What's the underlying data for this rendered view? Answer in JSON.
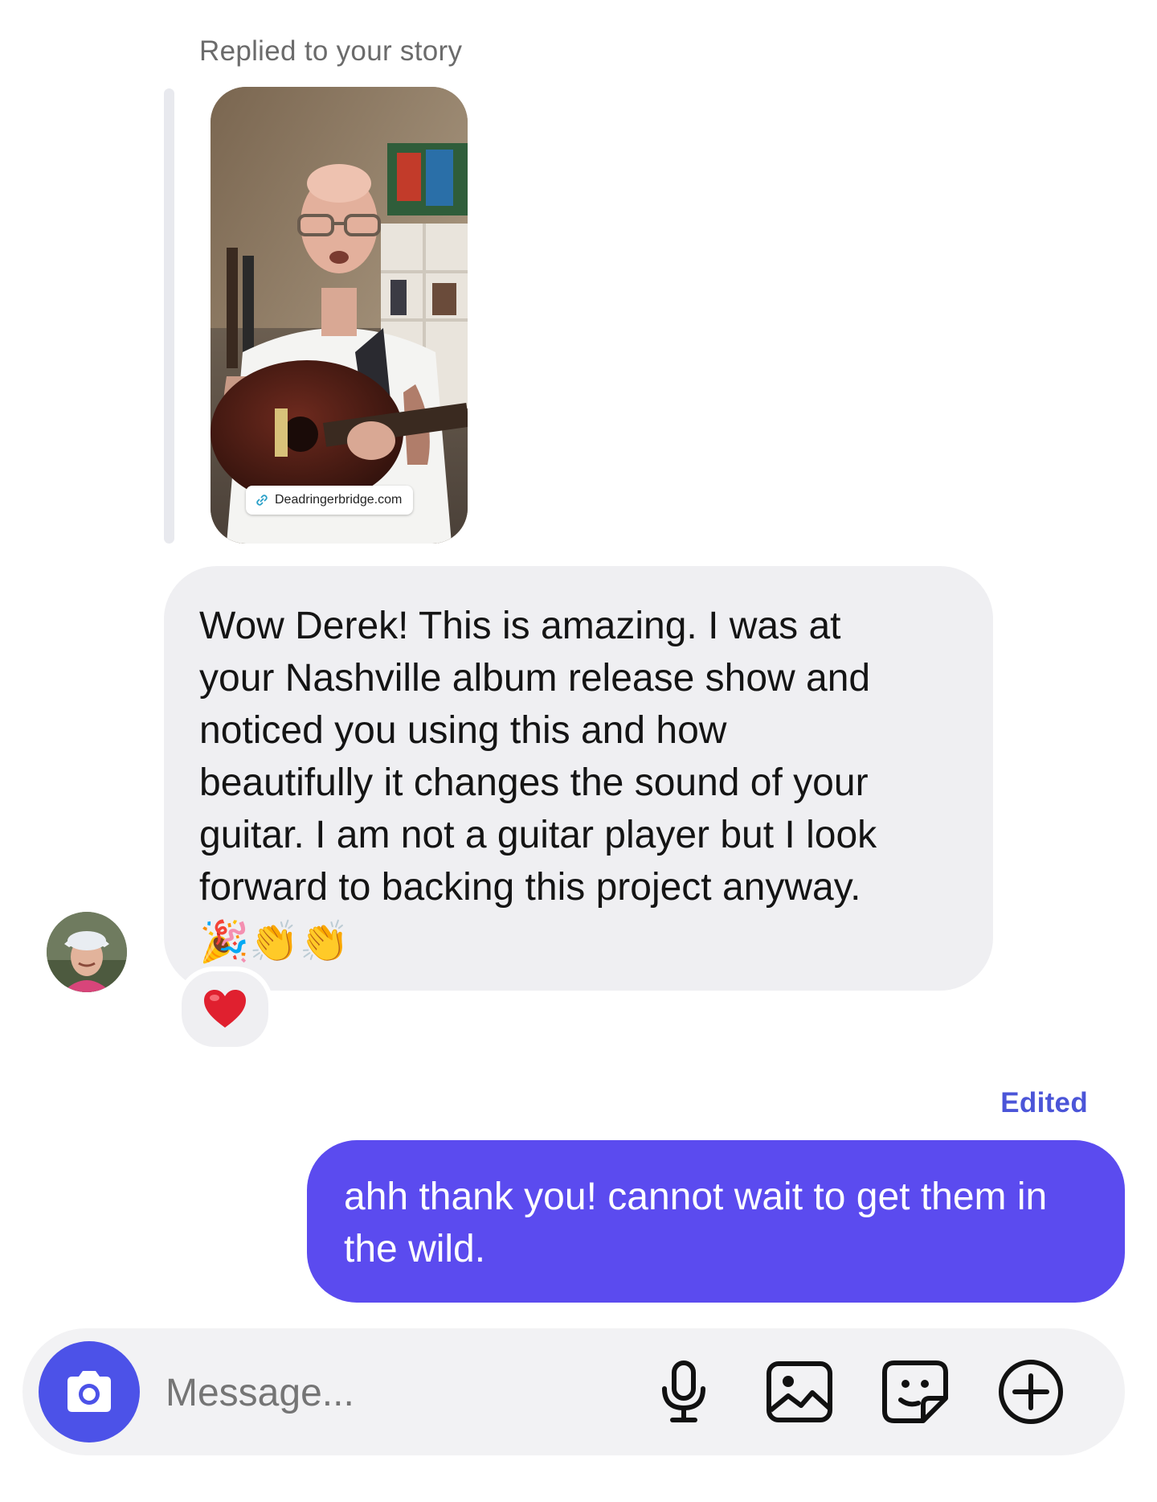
{
  "thread": {
    "reply_context_label": "Replied to your story",
    "story": {
      "link_sticker_text": "Deadringerbridge.com"
    },
    "incoming_message": {
      "text": "Wow Derek!  This is amazing. I was at\nyour Nashville album release show and\nnoticed you using this and how\nbeautifully it changes the sound of your\nguitar. I am not a guitar player but I look\nforward to backing this project anyway.",
      "emoji": "🎉👏👏",
      "reaction": "❤️"
    },
    "outgoing_message": {
      "status": "Edited",
      "text": "ahh thank you! cannot wait to get them in the wild."
    }
  },
  "composer": {
    "placeholder": "Message...",
    "icons": [
      "camera-icon",
      "microphone-icon",
      "gallery-icon",
      "sticker-icon",
      "add-icon"
    ]
  },
  "colors": {
    "accent": "#5b4bef",
    "camera_button": "#4c52e8",
    "incoming_bubble": "#efeff2",
    "edited_label": "#4b55d8",
    "reaction_heart": "#e0202f"
  }
}
